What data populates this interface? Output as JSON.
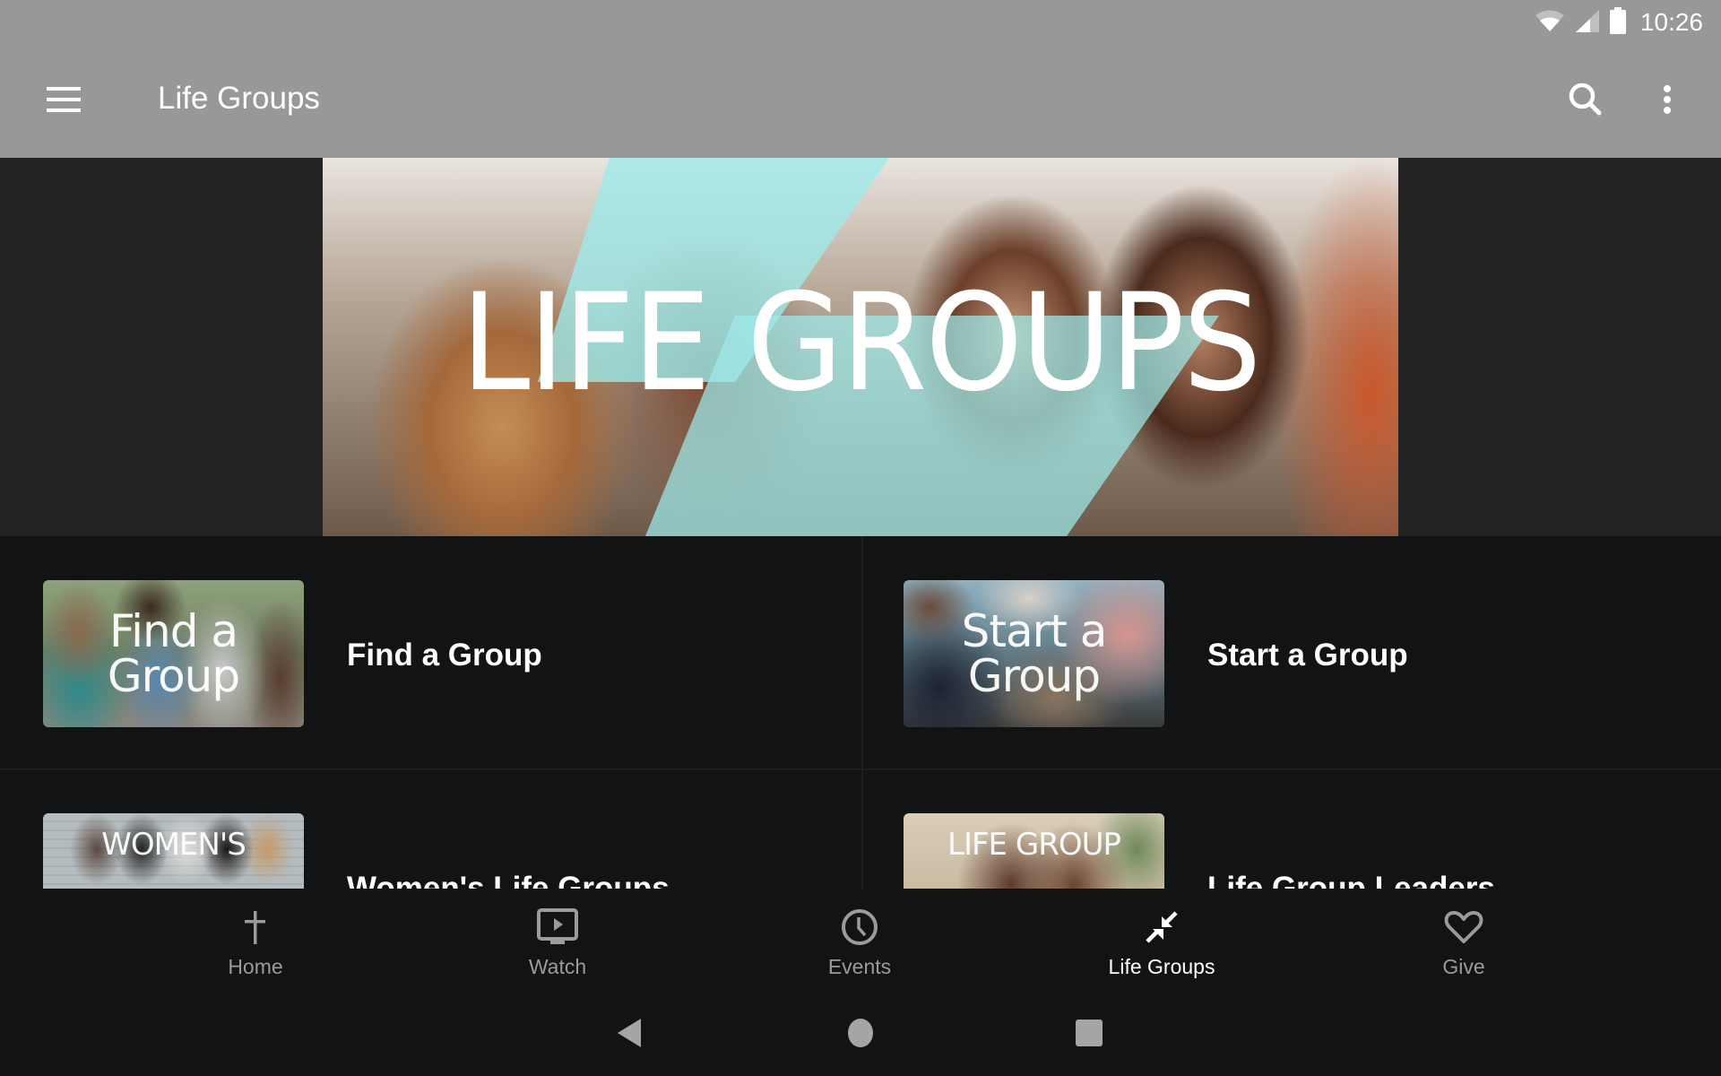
{
  "status_bar": {
    "time": "10:26",
    "icons": [
      "wifi-icon",
      "cellular-signal-icon",
      "battery-icon"
    ]
  },
  "app_bar": {
    "title": "Life Groups",
    "menu_icon": "hamburger-menu-icon",
    "actions": [
      "search-icon",
      "more-vert-icon"
    ]
  },
  "banner": {
    "title": "LIFE GROUPS",
    "accent_color": "#9eeaea"
  },
  "tiles": [
    {
      "label": "Find a Group",
      "thumb_text": [
        "Find a",
        "Group"
      ]
    },
    {
      "label": "Start a Group",
      "thumb_text": [
        "Start a",
        "Group"
      ]
    },
    {
      "label": "Women's Life Groups",
      "thumb_text": [
        "WOMEN'S"
      ]
    },
    {
      "label": "Life Group Leaders",
      "thumb_text": [
        "LIFE GROUP"
      ]
    }
  ],
  "bottom_nav": {
    "items": [
      {
        "label": "Home",
        "icon": "cross-icon",
        "active": false
      },
      {
        "label": "Watch",
        "icon": "tv-play-icon",
        "active": false
      },
      {
        "label": "Events",
        "icon": "clock-icon",
        "active": false
      },
      {
        "label": "Life Groups",
        "icon": "arrows-collapse-icon",
        "active": true
      },
      {
        "label": "Give",
        "icon": "heart-icon",
        "active": false
      }
    ],
    "active_color": "#ffffff",
    "inactive_color": "#9a9b9c"
  },
  "system_nav": {
    "buttons": [
      "back",
      "home",
      "recents"
    ]
  }
}
